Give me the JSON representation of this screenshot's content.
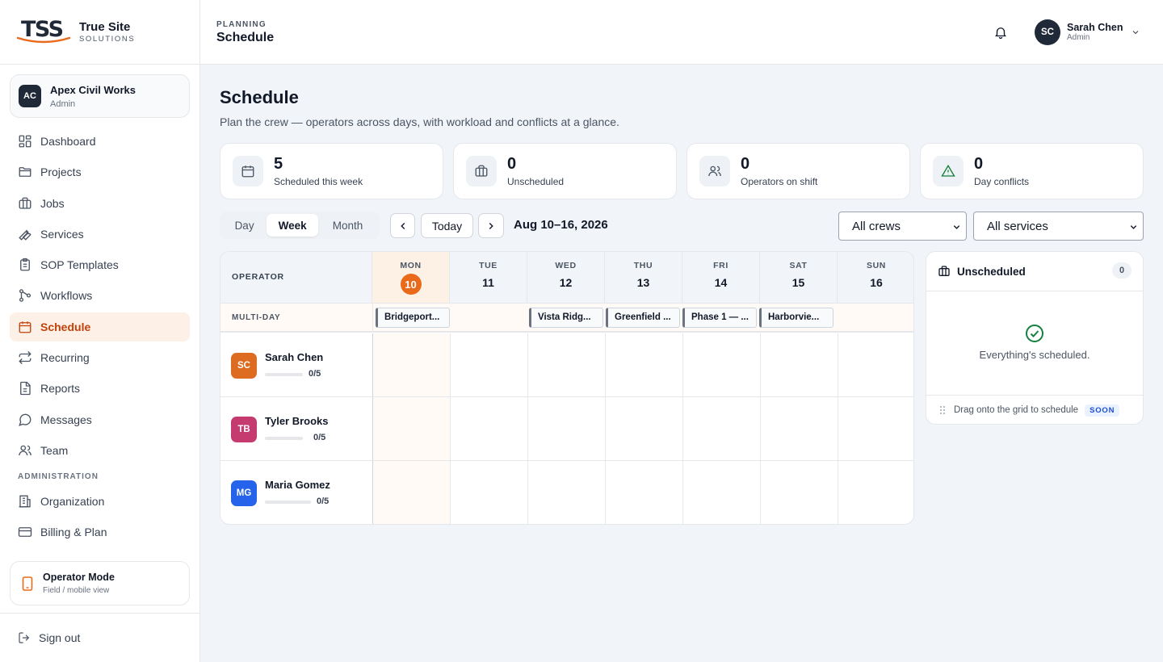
{
  "brand": {
    "mark": "TSS",
    "name": "True Site",
    "tagline": "SOLUTIONS",
    "accent": "#ea6a1c"
  },
  "org": {
    "initials": "AC",
    "name": "Apex Civil Works",
    "role": "Admin"
  },
  "nav": [
    {
      "label": "Dashboard",
      "icon": "dashboard-icon"
    },
    {
      "label": "Projects",
      "icon": "folder-icon"
    },
    {
      "label": "Jobs",
      "icon": "briefcase-icon"
    },
    {
      "label": "Services",
      "icon": "wrench-icon"
    },
    {
      "label": "SOP Templates",
      "icon": "clipboard-icon"
    },
    {
      "label": "Workflows",
      "icon": "workflow-icon"
    },
    {
      "label": "Schedule",
      "icon": "calendar-icon",
      "active": true
    },
    {
      "label": "Recurring",
      "icon": "repeat-icon"
    },
    {
      "label": "Reports",
      "icon": "report-icon"
    },
    {
      "label": "Messages",
      "icon": "message-icon"
    },
    {
      "label": "Team",
      "icon": "users-icon"
    }
  ],
  "admin_section": "ADMINISTRATION",
  "admin_nav": [
    {
      "label": "Organization",
      "icon": "building-icon"
    },
    {
      "label": "Billing & Plan",
      "icon": "credit-card-icon"
    }
  ],
  "operator_mode": {
    "title": "Operator Mode",
    "subtitle": "Field / mobile view"
  },
  "signout": "Sign out",
  "topbar": {
    "crumb": "PLANNING",
    "title": "Schedule"
  },
  "user": {
    "initials": "SC",
    "name": "Sarah Chen",
    "role": "Admin"
  },
  "page": {
    "title": "Schedule",
    "subtitle": "Plan the crew — operators across days, with workload and conflicts at a glance."
  },
  "stats": [
    {
      "value": "5",
      "label": "Scheduled this week",
      "icon": "calendar-icon"
    },
    {
      "value": "0",
      "label": "Unscheduled",
      "icon": "briefcase-icon"
    },
    {
      "value": "0",
      "label": "Operators on shift",
      "icon": "users-icon"
    },
    {
      "value": "0",
      "label": "Day conflicts",
      "icon": "warning-icon"
    }
  ],
  "view": {
    "options": [
      "Day",
      "Week",
      "Month"
    ],
    "selected": "Week"
  },
  "today_label": "Today",
  "range": "Aug 10–16, 2026",
  "filters": {
    "crew": "All crews",
    "service": "All services"
  },
  "grid": {
    "operator_header": "OPERATOR",
    "multi_label": "MULTI-DAY",
    "days": [
      {
        "dow": "MON",
        "num": "10",
        "today": true
      },
      {
        "dow": "TUE",
        "num": "11"
      },
      {
        "dow": "WED",
        "num": "12"
      },
      {
        "dow": "THU",
        "num": "13"
      },
      {
        "dow": "FRI",
        "num": "14"
      },
      {
        "dow": "SAT",
        "num": "15"
      },
      {
        "dow": "SUN",
        "num": "16"
      }
    ],
    "multi_day": [
      {
        "label": "Bridgeport...",
        "day": 0
      },
      {
        "label": "Vista Ridg...",
        "day": 2
      },
      {
        "label": "Greenfield ...",
        "day": 3
      },
      {
        "label": "Phase 1 — ...",
        "day": 4
      },
      {
        "label": "Harborvie...",
        "day": 5
      }
    ],
    "operators": [
      {
        "initials": "SC",
        "name": "Sarah Chen",
        "load": "0/5",
        "color": "#dd6b20"
      },
      {
        "initials": "TB",
        "name": "Tyler Brooks",
        "load": "0/5",
        "color": "#c53a6f"
      },
      {
        "initials": "MG",
        "name": "Maria Gomez",
        "load": "0/5",
        "color": "#2563eb"
      }
    ]
  },
  "unscheduled": {
    "title": "Unscheduled",
    "count": "0",
    "empty": "Everything's scheduled.",
    "hint": "Drag onto the grid to schedule",
    "badge": "SOON"
  }
}
